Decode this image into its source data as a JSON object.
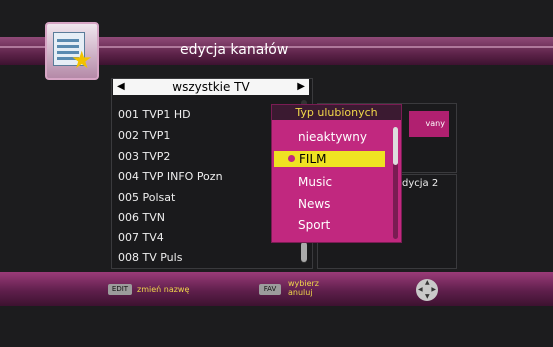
{
  "header": {
    "title": "edycja kanałów"
  },
  "group_selector": {
    "label": "wszystkie TV",
    "left_arrow": "◀",
    "right_arrow": "▶"
  },
  "channels": [
    "001 TVP1 HD",
    "002 TVP1",
    "003 TVP2",
    "004 TVP INFO Pozn",
    "005 Polsat",
    "006 TVN",
    "007 TV4",
    "008 TV Puls"
  ],
  "popup": {
    "title": "Typ ulubionych",
    "options": [
      "nieaktywny",
      "FILM",
      "Music",
      "News",
      "Sport"
    ],
    "selected": "FILM"
  },
  "right_panel": {
    "badge_text": "vany",
    "satellite_text": "dycja 2"
  },
  "footer": {
    "edit_key": "EDIT",
    "edit_hint": "zmień nazwę",
    "fav_key": "FAV",
    "fav_hint_1": "wybierz",
    "fav_hint_2": "anuluj"
  },
  "colors": {
    "accent": "#c1287f",
    "highlight": "#efe322"
  }
}
